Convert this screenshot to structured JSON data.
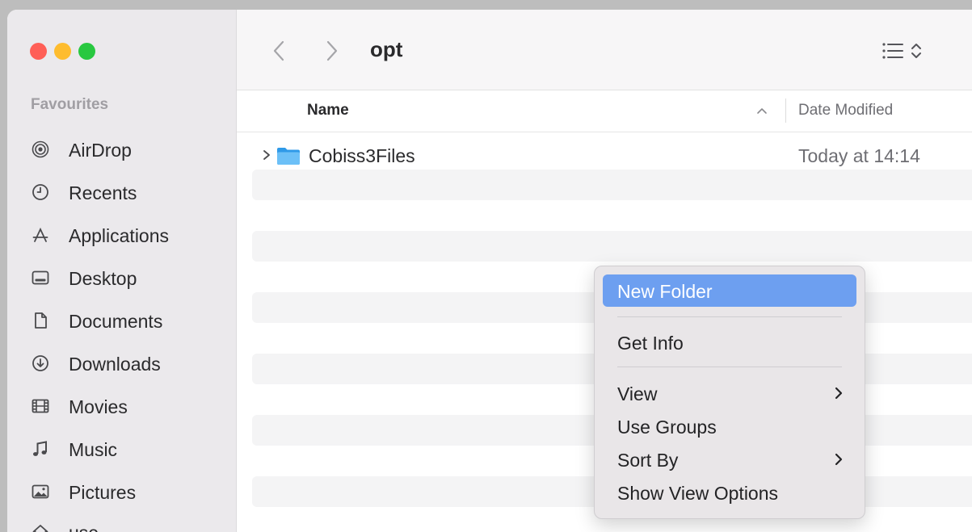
{
  "window": {
    "folder_title": "opt"
  },
  "sidebar": {
    "section_label": "Favourites",
    "items": [
      {
        "label": "AirDrop",
        "icon": "airdrop-icon"
      },
      {
        "label": "Recents",
        "icon": "clock-icon"
      },
      {
        "label": "Applications",
        "icon": "applications-icon"
      },
      {
        "label": "Desktop",
        "icon": "desktop-icon"
      },
      {
        "label": "Documents",
        "icon": "document-icon"
      },
      {
        "label": "Downloads",
        "icon": "download-icon"
      },
      {
        "label": "Movies",
        "icon": "film-icon"
      },
      {
        "label": "Music",
        "icon": "music-note-icon"
      },
      {
        "label": "Pictures",
        "icon": "picture-icon"
      },
      {
        "label": "use",
        "icon": "home-icon"
      }
    ]
  },
  "columns": {
    "name": "Name",
    "date_modified": "Date Modified"
  },
  "files": [
    {
      "name": "Cobiss3Files",
      "date": "Today at 14:14",
      "icon": "folder-icon"
    }
  ],
  "context_menu": {
    "items": [
      {
        "label": "New Folder",
        "highlighted": true
      },
      {
        "label": "Get Info"
      },
      {
        "label": "View",
        "submenu": true
      },
      {
        "label": "Use Groups"
      },
      {
        "label": "Sort By",
        "submenu": true
      },
      {
        "label": "Show View Options"
      }
    ]
  },
  "colors": {
    "accent_highlight": "#6d9ff0",
    "sidebar_bg": "#ebe9ec",
    "close": "#ff5f57",
    "minimize": "#febc2e",
    "zoom": "#28c840"
  }
}
